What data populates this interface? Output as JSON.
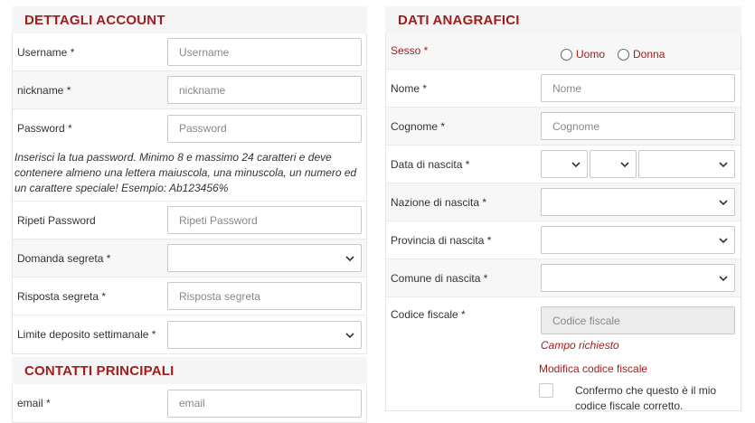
{
  "account": {
    "title": "DETTAGLI ACCOUNT",
    "username_label": "Username *",
    "username_placeholder": "Username",
    "nickname_label": "nickname *",
    "nickname_placeholder": "nickname",
    "password_label": "Password *",
    "password_placeholder": "Password",
    "password_hint": "Inserisci la tua password. Minimo 8 e massimo 24 caratteri e deve contenere almeno una lettera maiuscola, una minuscola, un numero ed un carattere speciale! Esempio: Ab123456%",
    "repeat_label": "Ripeti Password",
    "repeat_placeholder": "Ripeti Password",
    "question_label": "Domanda segreta *",
    "answer_label": "Risposta segreta *",
    "answer_placeholder": "Risposta segreta",
    "limit_label": "Limite deposito settimanale *"
  },
  "contacts": {
    "title": "CONTATTI PRINCIPALI",
    "email_label": "email *",
    "email_placeholder": "email"
  },
  "personal": {
    "title": "DATI ANAGRAFICI",
    "sex_label": "Sesso *",
    "male": "Uomo",
    "female": "Donna",
    "name_label": "Nome *",
    "name_placeholder": "Nome",
    "surname_label": "Cognome *",
    "surname_placeholder": "Cognome",
    "birthdate_label": "Data di nascita *",
    "country_label": "Nazione di nascita *",
    "province_label": "Provincia di nascita *",
    "city_label": "Comune di nascita *",
    "fiscal_label": "Codice fiscale *",
    "fiscal_placeholder": "Codice fiscale",
    "required_msg": "Campo richiesto",
    "modify_link": "Modifica codice fiscale",
    "confirm_text": "Confermo che questo è il mio codice fiscale corretto."
  },
  "colors": {
    "accent": "#a31c1c",
    "header_bg": "#f5f5f5",
    "row_alt": "#f7f7f7"
  },
  "icons": {
    "select_arrow": "chevron-down-icon"
  }
}
